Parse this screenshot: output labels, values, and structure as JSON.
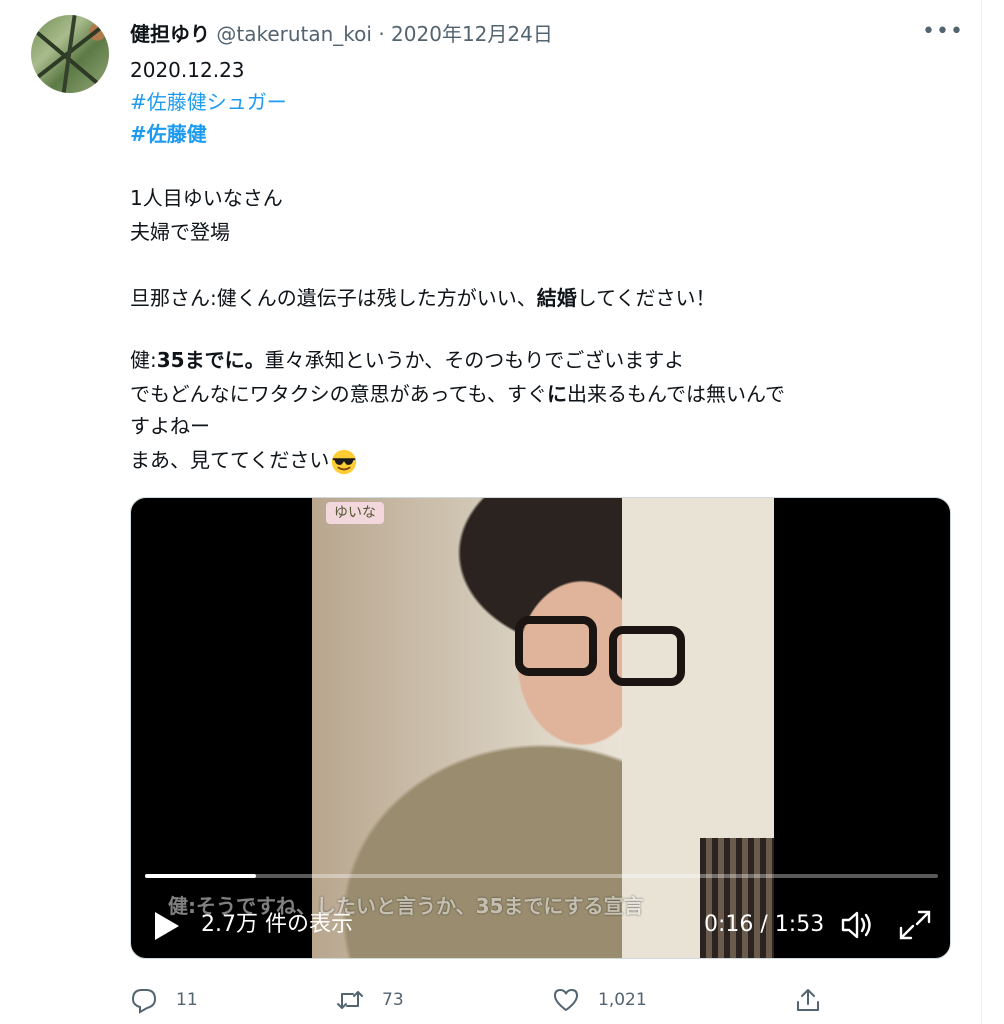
{
  "author": {
    "display_name": "健担ゆり",
    "handle": "@takerutan_koi",
    "separator": "·",
    "date": "2020年12月24日"
  },
  "menu": {
    "more_label": "•••"
  },
  "tweet": {
    "line_date": "2020.12.23",
    "hashtag1": "#佐藤健シュガー",
    "hashtag2": "#佐藤健",
    "line1": "1人目ゆいなさん",
    "line2": "夫婦で登場",
    "line3_before": "旦那さん:健くんの遺伝子は残した方がいい、",
    "line3_bold": "結婚",
    "line3_after": "してください！",
    "line4_prefix": "健:",
    "line4_bold": "35までに。",
    "line4_rest": "重々承知というか、そのつもりでございますよ",
    "line5_before": "でもどんなにワタクシの意思があっても、すぐ",
    "line5_bold": "に",
    "line5_after": "出来るもんでは無いんで",
    "line6": "すよねー",
    "line7": "まあ、見ててください",
    "emoji": "smiling-face-with-sunglasses"
  },
  "video": {
    "overlay_name": "ゆいな",
    "caption": "健:そうですね、したいと言うか、35までにする宣言",
    "views": "2.7万 件の表示",
    "time": "0:16 / 1:53",
    "progress": 0.14
  },
  "actions": {
    "reply_count": "11",
    "retweet_count": "73",
    "like_count": "1,021"
  },
  "colors": {
    "link": "#1d9bf0",
    "text": "#0f1419",
    "muted": "#536471"
  }
}
